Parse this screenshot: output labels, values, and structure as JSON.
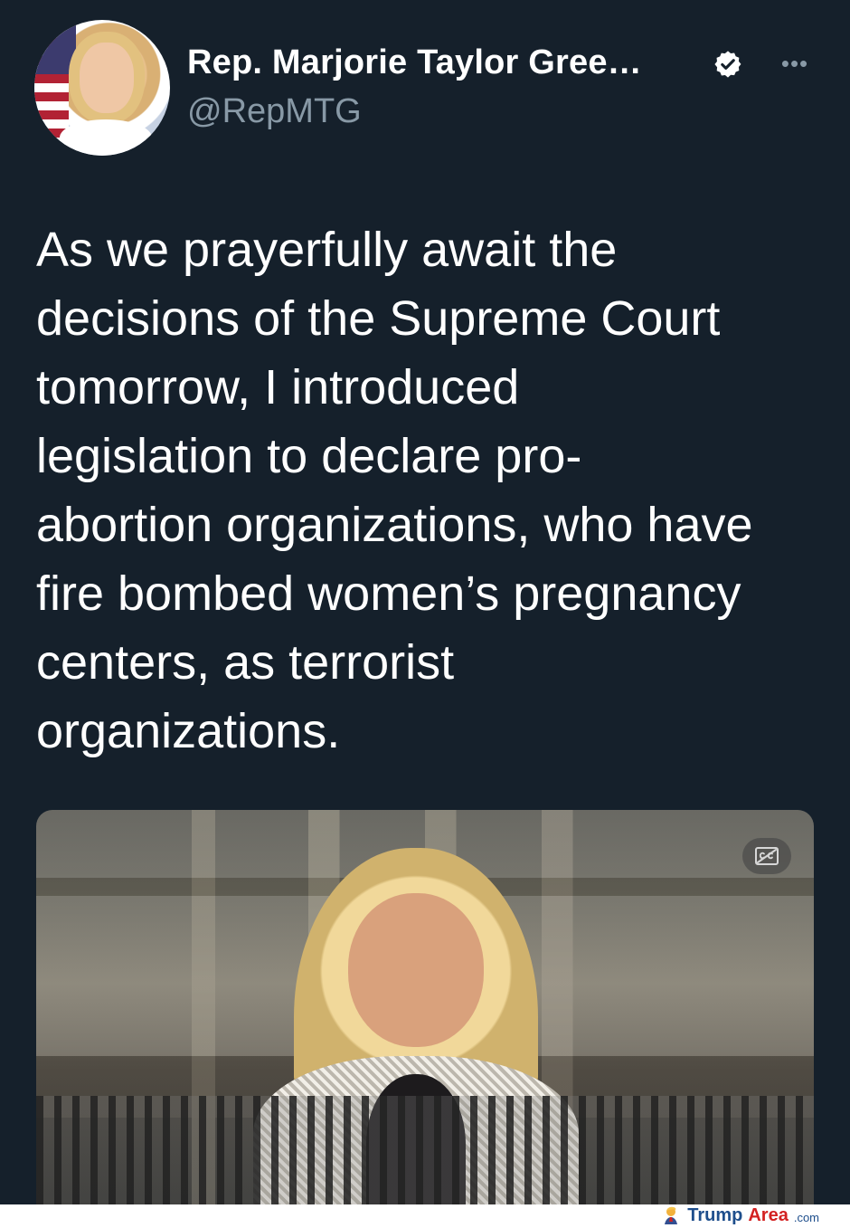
{
  "tweet": {
    "display_name": "Rep. Marjorie Taylor Gree…",
    "handle": "@RepMTG",
    "text": "As we prayerfully await the\ndecisions of the Supreme Court\ntomorrow, I introduced\nlegislation to declare pro-\nabortion organizations, who have\nfire bombed women’s pregnancy\ncenters, as terrorist\norganizations.",
    "more_icon": "ellipsis-icon",
    "verified_icon": "verified-icon"
  },
  "media": {
    "caption_icon": "cc-icon"
  },
  "watermark": {
    "brand_main": "Trump",
    "brand_accent": "Area",
    "brand_suffix": ".com",
    "icon": "trump-icon"
  },
  "colors": {
    "background": "#15202b",
    "secondary_text": "#8899a6",
    "verified_badge": "#ffffff",
    "watermark_blue": "#1e4e8c",
    "watermark_red": "#d32121"
  }
}
